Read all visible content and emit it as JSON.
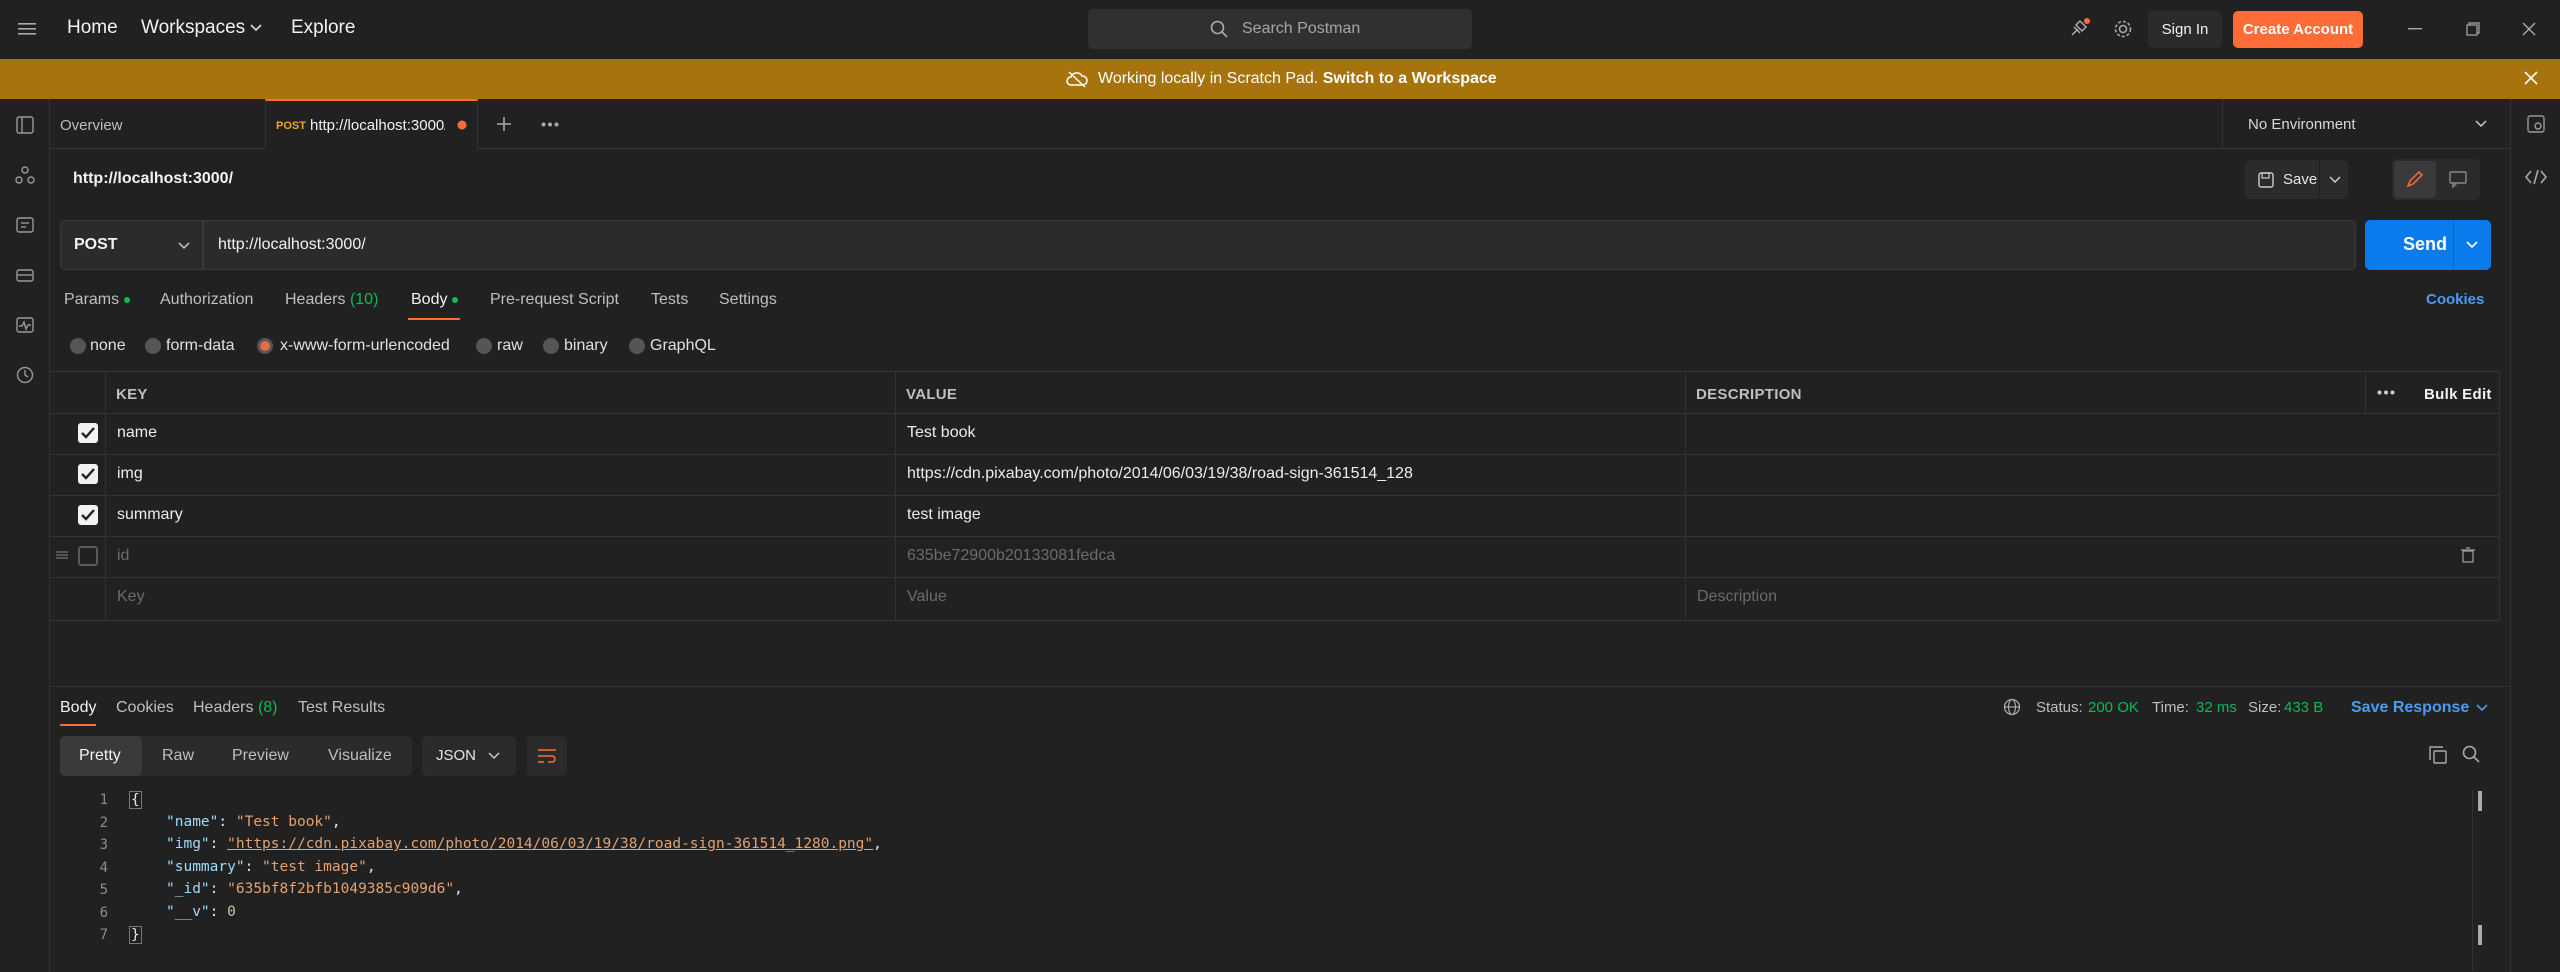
{
  "topbar": {
    "home": "Home",
    "workspaces": "Workspaces",
    "explore": "Explore",
    "search_placeholder": "Search Postman",
    "sign_in": "Sign In",
    "create_account": "Create Account"
  },
  "banner": {
    "message": "Working locally in Scratch Pad.",
    "link": "Switch to a Workspace"
  },
  "tabs": {
    "overview": "Overview",
    "active_method": "POST",
    "active_url": "http://localhost:3000/"
  },
  "environment": "No Environment",
  "request": {
    "title": "http://localhost:3000/",
    "save_label": "Save",
    "method": "POST",
    "url": "http://localhost:3000/",
    "send_label": "Send"
  },
  "request_tabs": {
    "params": "Params",
    "authorization": "Authorization",
    "headers": "Headers",
    "headers_count": "(10)",
    "body": "Body",
    "prerequest": "Pre-request Script",
    "tests": "Tests",
    "settings": "Settings",
    "cookies": "Cookies"
  },
  "body_types": {
    "none": "none",
    "form_data": "form-data",
    "urlencoded": "x-www-form-urlencoded",
    "raw": "raw",
    "binary": "binary",
    "graphql": "GraphQL",
    "selected": "x-www-form-urlencoded"
  },
  "table": {
    "headers": {
      "key": "KEY",
      "value": "VALUE",
      "description": "DESCRIPTION",
      "bulk_edit": "Bulk Edit"
    },
    "rows": [
      {
        "checked": true,
        "key": "name",
        "value": "Test book"
      },
      {
        "checked": true,
        "key": "img",
        "value": "https://cdn.pixabay.com/photo/2014/06/03/19/38/road-sign-361514_128"
      },
      {
        "checked": true,
        "key": "summary",
        "value": "test image"
      },
      {
        "checked": false,
        "key": "id",
        "value": "635be72900b20133081fedca"
      }
    ],
    "placeholders": {
      "key": "Key",
      "value": "Value",
      "description": "Description"
    }
  },
  "response": {
    "tabs": {
      "body": "Body",
      "cookies": "Cookies",
      "headers": "Headers",
      "headers_count": "(8)",
      "test_results": "Test Results"
    },
    "status_label": "Status:",
    "status_value": "200 OK",
    "time_label": "Time:",
    "time_value": "32 ms",
    "size_label": "Size:",
    "size_value": "433 B",
    "save_response": "Save Response",
    "views": {
      "pretty": "Pretty",
      "raw": "Raw",
      "preview": "Preview",
      "visualize": "Visualize"
    },
    "format": "JSON",
    "line_numbers": [
      "1",
      "2",
      "3",
      "4",
      "5",
      "6",
      "7"
    ],
    "json": {
      "open": "{",
      "close": "}",
      "name_key": "\"name\"",
      "name_val": "\"Test book\"",
      "img_key": "\"img\"",
      "img_val": "\"https://cdn.pixabay.com/photo/2014/06/03/19/38/road-sign-361514_1280.png\"",
      "summary_key": "\"summary\"",
      "summary_val": "\"test image\"",
      "id_key": "\"_id\"",
      "id_val": "\"635bf8f2bfb1049385c909d6\"",
      "v_key": "\"__v\"",
      "v_val": "0"
    }
  },
  "colors": {
    "accent": "#ff6c37",
    "send": "#097bed",
    "banner": "#a6730d",
    "success": "#0cbb52",
    "link": "#4a9cf0"
  }
}
